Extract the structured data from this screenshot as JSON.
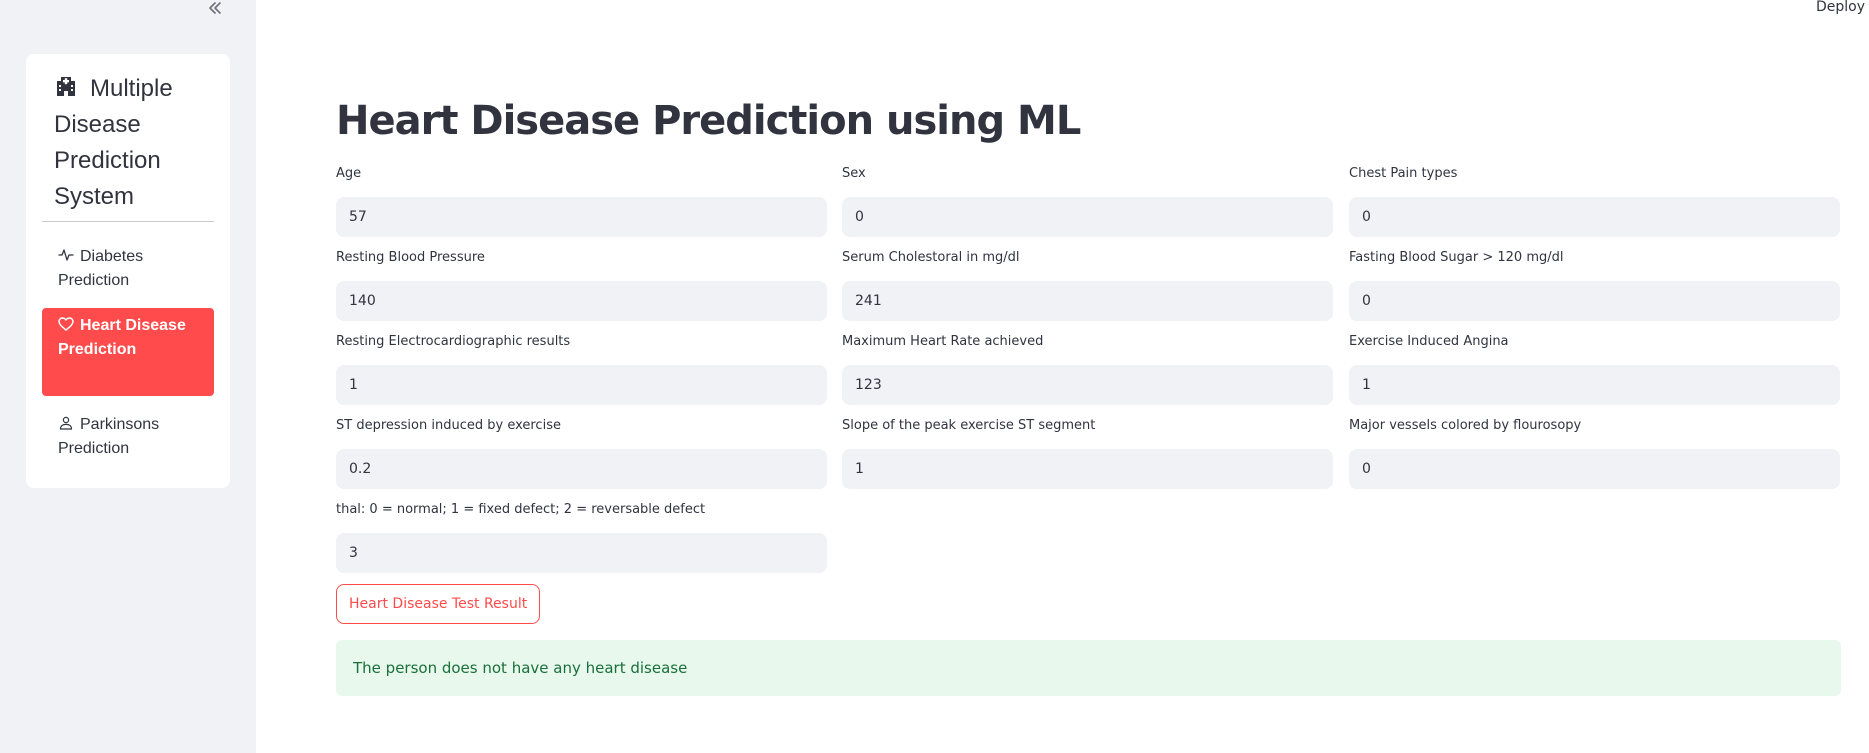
{
  "header": {
    "deploy_label": "Deploy"
  },
  "sidebar": {
    "collapse_icon": "double-chevron-left-icon",
    "title": "Multiple Disease Prediction System",
    "title_icon": "hospital-icon",
    "items": [
      {
        "label": "Diabetes Prediction",
        "icon": "activity-icon",
        "selected": false
      },
      {
        "label": "Heart Disease Prediction",
        "icon": "heart-icon",
        "selected": true
      },
      {
        "label": "Parkinsons Prediction",
        "icon": "person-icon",
        "selected": false
      }
    ],
    "selected_color": "#ff4b4b"
  },
  "main": {
    "title": "Heart Disease Prediction using ML",
    "fields": [
      {
        "label": "Age",
        "value": "57"
      },
      {
        "label": "Sex",
        "value": "0"
      },
      {
        "label": "Chest Pain types",
        "value": "0"
      },
      {
        "label": "Resting Blood Pressure",
        "value": "140"
      },
      {
        "label": "Serum Cholestoral in mg/dl",
        "value": "241"
      },
      {
        "label": "Fasting Blood Sugar > 120 mg/dl",
        "value": "0"
      },
      {
        "label": "Resting Electrocardiographic results",
        "value": "1"
      },
      {
        "label": "Maximum Heart Rate achieved",
        "value": "123"
      },
      {
        "label": "Exercise Induced Angina",
        "value": "1"
      },
      {
        "label": "ST depression induced by exercise",
        "value": "0.2"
      },
      {
        "label": "Slope of the peak exercise ST segment",
        "value": "1"
      },
      {
        "label": "Major vessels colored by flourosopy",
        "value": "0"
      },
      {
        "label": "thal: 0 = normal; 1 = fixed defect; 2 = reversable defect",
        "value": "3"
      }
    ],
    "submit_label": "Heart Disease Test Result",
    "result_message": "The person does not have any heart disease",
    "accent_color": "#ff4b4b",
    "success_color": "#18703a"
  }
}
